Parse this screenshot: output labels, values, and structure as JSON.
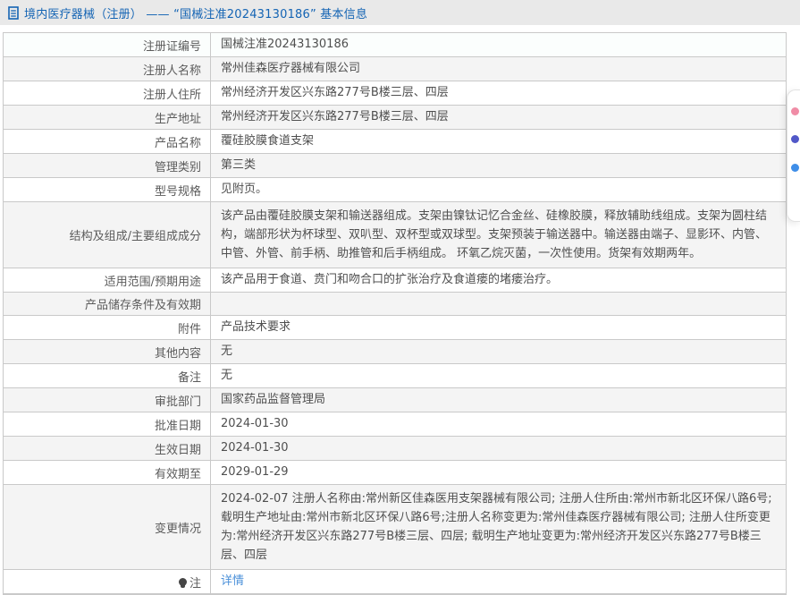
{
  "header": {
    "title": "境内医疗器械（注册） —— “国械注准20243130186” 基本信息"
  },
  "table": {
    "rows": [
      {
        "label": "注册证编号",
        "value": "国械注准20243130186"
      },
      {
        "label": "注册人名称",
        "value": "常州佳森医疗器械有限公司"
      },
      {
        "label": "注册人住所",
        "value": "常州经济开发区兴东路277号B楼三层、四层"
      },
      {
        "label": "生产地址",
        "value": "常州经济开发区兴东路277号B楼三层、四层"
      },
      {
        "label": "产品名称",
        "value": "覆硅胶膜食道支架"
      },
      {
        "label": "管理类别",
        "value": "第三类"
      },
      {
        "label": "型号规格",
        "value": "见附页。"
      },
      {
        "label": "结构及组成/主要组成成分",
        "value": "该产品由覆硅胶膜支架和输送器组成。支架由镍钛记忆合金丝、硅橡胶膜，释放辅助线组成。支架为圆柱结构，端部形状为杯球型、双叭型、双杯型或双球型。支架预装于输送器中。输送器由端子、显影环、内管、中管、外管、前手柄、助推管和后手柄组成。 环氧乙烷灭菌，一次性使用。货架有效期两年。",
        "tall": true
      },
      {
        "label": "适用范围/预期用途",
        "value": "该产品用于食道、贲门和吻合口的扩张治疗及食道瘘的堵瘘治疗。"
      },
      {
        "label": "产品储存条件及有效期",
        "value": ""
      },
      {
        "label": "附件",
        "value": "产品技术要求"
      },
      {
        "label": "其他内容",
        "value": "无"
      },
      {
        "label": "备注",
        "value": "无"
      },
      {
        "label": "审批部门",
        "value": "国家药品监督管理局"
      },
      {
        "label": "批准日期",
        "value": "2024-01-30"
      },
      {
        "label": "生效日期",
        "value": "2024-01-30"
      },
      {
        "label": "有效期至",
        "value": "2029-01-29"
      },
      {
        "label": "变更情况",
        "value": "2024-02-07 注册人名称由:常州新区佳森医用支架器械有限公司; 注册人住所由:常州市新北区环保八路6号; 载明生产地址由:常州市新北区环保八路6号;注册人名称变更为:常州佳森医疗器械有限公司; 注册人住所变更为:常州经济开发区兴东路277号B楼三层、四层; 载明生产地址变更为:常州经济开发区兴东路277号B楼三层、四层",
        "tall": true
      },
      {
        "label": "注",
        "label_icon": "bulb-icon",
        "value": "详情",
        "link": true
      }
    ]
  },
  "side_panel": {
    "icons": [
      {
        "name": "pink-icon",
        "color": "#f08ca6"
      },
      {
        "name": "indigo-icon",
        "color": "#5158c8"
      },
      {
        "name": "blue-icon",
        "color": "#3f8ee8"
      }
    ]
  },
  "colors": {
    "accent_blue": "#1464b4",
    "link_blue": "#4a90d9",
    "header_bg": "#e9e9e9",
    "row_stripe": "#f4f4f4",
    "border": "#c9c9c9"
  }
}
